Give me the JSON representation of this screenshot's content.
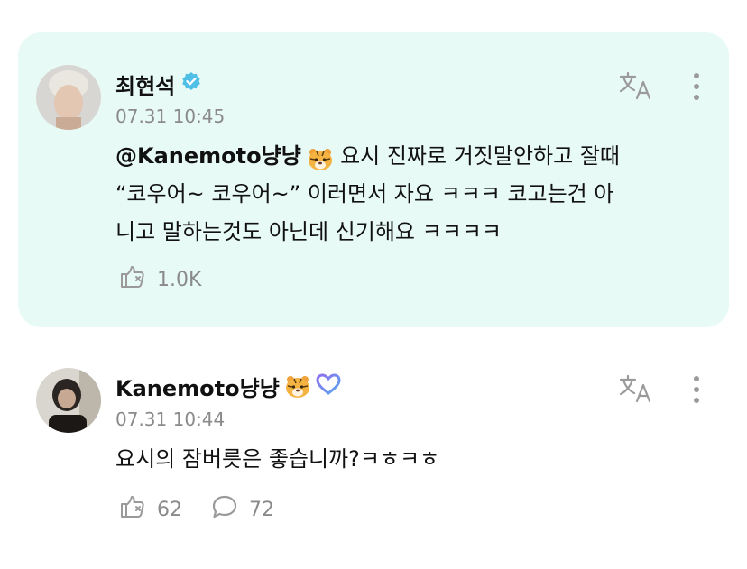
{
  "posts": [
    {
      "author": "최현석",
      "verified_badge": "verified-check-icon",
      "timestamp": "07.31 10:45",
      "mention": "@Kanemoto냥냥",
      "text_line1_after": "요시 진짜로 거짓말안하고 잘때",
      "text_line2": "“코우어~ 코우어~” 이러면서 자요 ㅋㅋㅋ 코고는건 아",
      "text_line3": "니고 말하는것도 아닌데 신기해요 ㅋㅋㅋㅋ",
      "like_count": "1.0K",
      "translate_icon": "translate-icon",
      "more_icon": "more-vertical-icon",
      "highlight_color": "#e8faf6"
    },
    {
      "author": "Kanemoto냥냥",
      "badge": "purple-heart-icon",
      "timestamp": "07.31 10:44",
      "text": "요시의 잠버릇은 좋습니까?ㅋㅎㅋㅎ",
      "like_count": "62",
      "comment_count": "72",
      "translate_icon": "translate-icon",
      "more_icon": "more-vertical-icon"
    }
  ]
}
